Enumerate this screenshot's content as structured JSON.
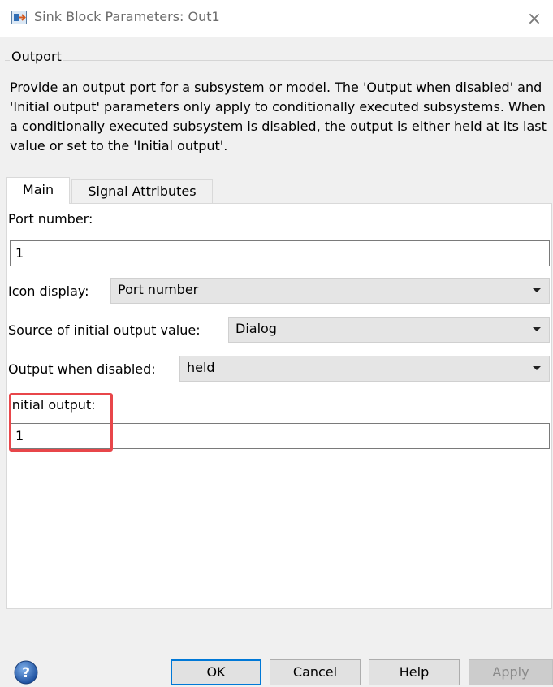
{
  "window": {
    "title": "Sink Block Parameters: Out1",
    "close_glyph": "×"
  },
  "group": {
    "title": "Outport",
    "description": "Provide an output port for a subsystem or model.  The 'Output when disabled' and 'Initial output' parameters only apply to conditionally executed subsystems. When a conditionally executed subsystem is disabled, the output is either held at its last value or set to the 'Initial output'."
  },
  "tabs": [
    {
      "label": "Main",
      "active": true
    },
    {
      "label": "Signal Attributes",
      "active": false
    }
  ],
  "fields": {
    "port_number": {
      "label": "Port number:",
      "value": "1"
    },
    "icon_display": {
      "label": "Icon display:",
      "value": "Port number"
    },
    "source_initial": {
      "label": "Source of initial output value:",
      "value": "Dialog"
    },
    "output_disabled": {
      "label": "Output when disabled:",
      "value": "held"
    },
    "initial_output": {
      "label": "Initial output:",
      "value": "1"
    }
  },
  "buttons": {
    "ok": "OK",
    "cancel": "Cancel",
    "help": "Help",
    "apply": "Apply"
  },
  "icons": {
    "app": "simulink-block-icon",
    "help": "help-question-icon",
    "dropdown": "chevron-down-icon"
  },
  "colors": {
    "highlight_border": "#e8464a",
    "ok_border": "#0078d7",
    "dialog_bg": "#f0f0f0"
  }
}
